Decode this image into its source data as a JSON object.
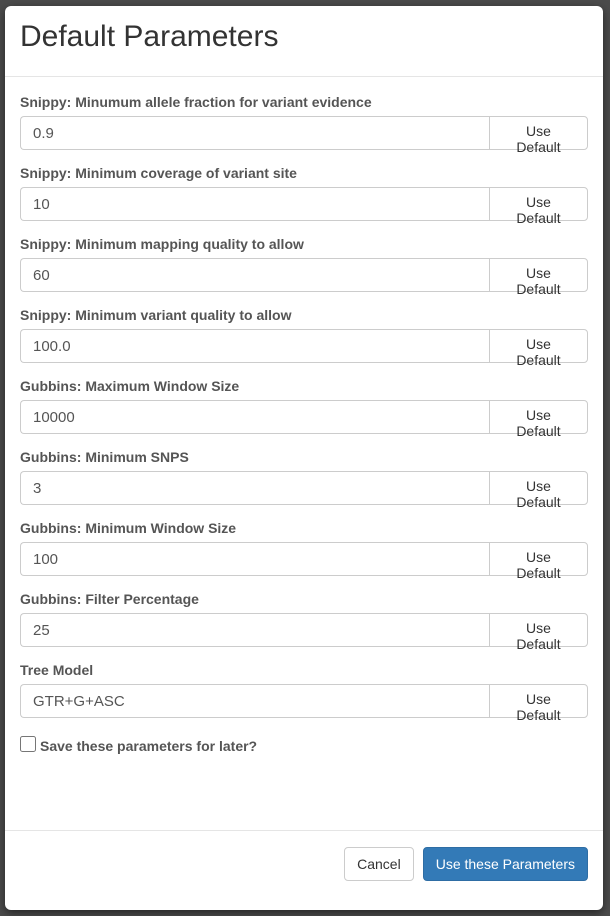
{
  "dialog": {
    "title": "Default Parameters"
  },
  "parameters": [
    {
      "label": "Snippy: Minumum allele fraction for variant evidence",
      "value": "0.9",
      "button": "Use Default"
    },
    {
      "label": "Snippy: Minimum coverage of variant site",
      "value": "10",
      "button": "Use Default"
    },
    {
      "label": "Snippy: Minimum mapping quality to allow",
      "value": "60",
      "button": "Use Default"
    },
    {
      "label": "Snippy: Minimum variant quality to allow",
      "value": "100.0",
      "button": "Use Default"
    },
    {
      "label": "Gubbins: Maximum Window Size",
      "value": "10000",
      "button": "Use Default"
    },
    {
      "label": "Gubbins: Minimum SNPS",
      "value": "3",
      "button": "Use Default"
    },
    {
      "label": "Gubbins: Minimum Window Size",
      "value": "100",
      "button": "Use Default"
    },
    {
      "label": "Gubbins: Filter Percentage",
      "value": "25",
      "button": "Use Default"
    },
    {
      "label": "Tree Model",
      "value": "GTR+G+ASC",
      "button": "Use Default"
    }
  ],
  "save_checkbox": {
    "label": "Save these parameters for later?",
    "checked": false
  },
  "footer": {
    "cancel_label": "Cancel",
    "submit_label": "Use these Parameters"
  },
  "colors": {
    "primary": "#337ab7",
    "label": "#555555",
    "border": "#cccccc"
  }
}
